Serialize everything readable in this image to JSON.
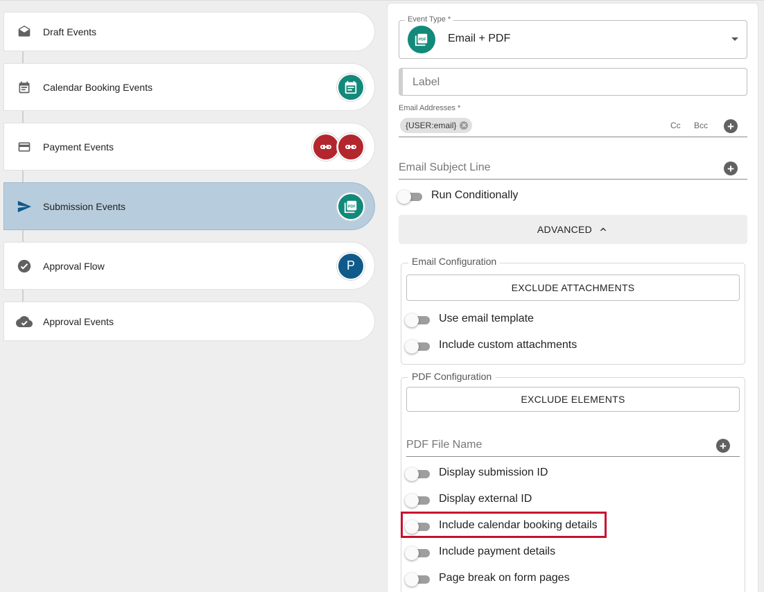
{
  "timeline": [
    {
      "id": "draft",
      "label": "Draft Events",
      "icon": "envelope-open-icon",
      "badges": []
    },
    {
      "id": "calendar",
      "label": "Calendar Booking Events",
      "icon": "calendar-icon",
      "badges": [
        "calendar-badge-icon"
      ]
    },
    {
      "id": "payment",
      "label": "Payment Events",
      "icon": "credit-card-icon",
      "badges": [
        "payment-link-icon",
        "payment-link-icon"
      ]
    },
    {
      "id": "submission",
      "label": "Submission Events",
      "icon": "send-icon",
      "badges": [
        "pdf-badge-icon"
      ],
      "active": true
    },
    {
      "id": "approval-flow",
      "label": "Approval Flow",
      "icon": "check-circle-icon",
      "badges": [
        "P"
      ]
    },
    {
      "id": "approval-events",
      "label": "Approval Events",
      "icon": "cloud-check-icon",
      "badges": []
    }
  ],
  "form": {
    "event_type_legend": "Event Type *",
    "event_type_value": "Email + PDF",
    "event_type_icon_text": "PDF",
    "label_placeholder": "Label",
    "email_addresses_label": "Email Addresses *",
    "email_chip": "{USER:email}",
    "cc": "Cc",
    "bcc": "Bcc",
    "subject_placeholder": "Email Subject Line",
    "run_conditionally": "Run Conditionally",
    "advanced": "ADVANCED",
    "email_config": {
      "legend": "Email Configuration",
      "exclude_button": "EXCLUDE ATTACHMENTS",
      "toggles": [
        "Use email template",
        "Include custom attachments"
      ]
    },
    "pdf_config": {
      "legend": "PDF Configuration",
      "exclude_button": "EXCLUDE ELEMENTS",
      "file_name_placeholder": "PDF File Name",
      "toggles": [
        "Display submission ID",
        "Display external ID",
        "Include calendar booking details",
        "Include payment details",
        "Page break on form pages"
      ]
    }
  },
  "colors": {
    "teal": "#12897a",
    "red": "#b3262e",
    "blue": "#0f5a8a",
    "active_card": "#b7cddd",
    "highlight": "#c8102e"
  }
}
